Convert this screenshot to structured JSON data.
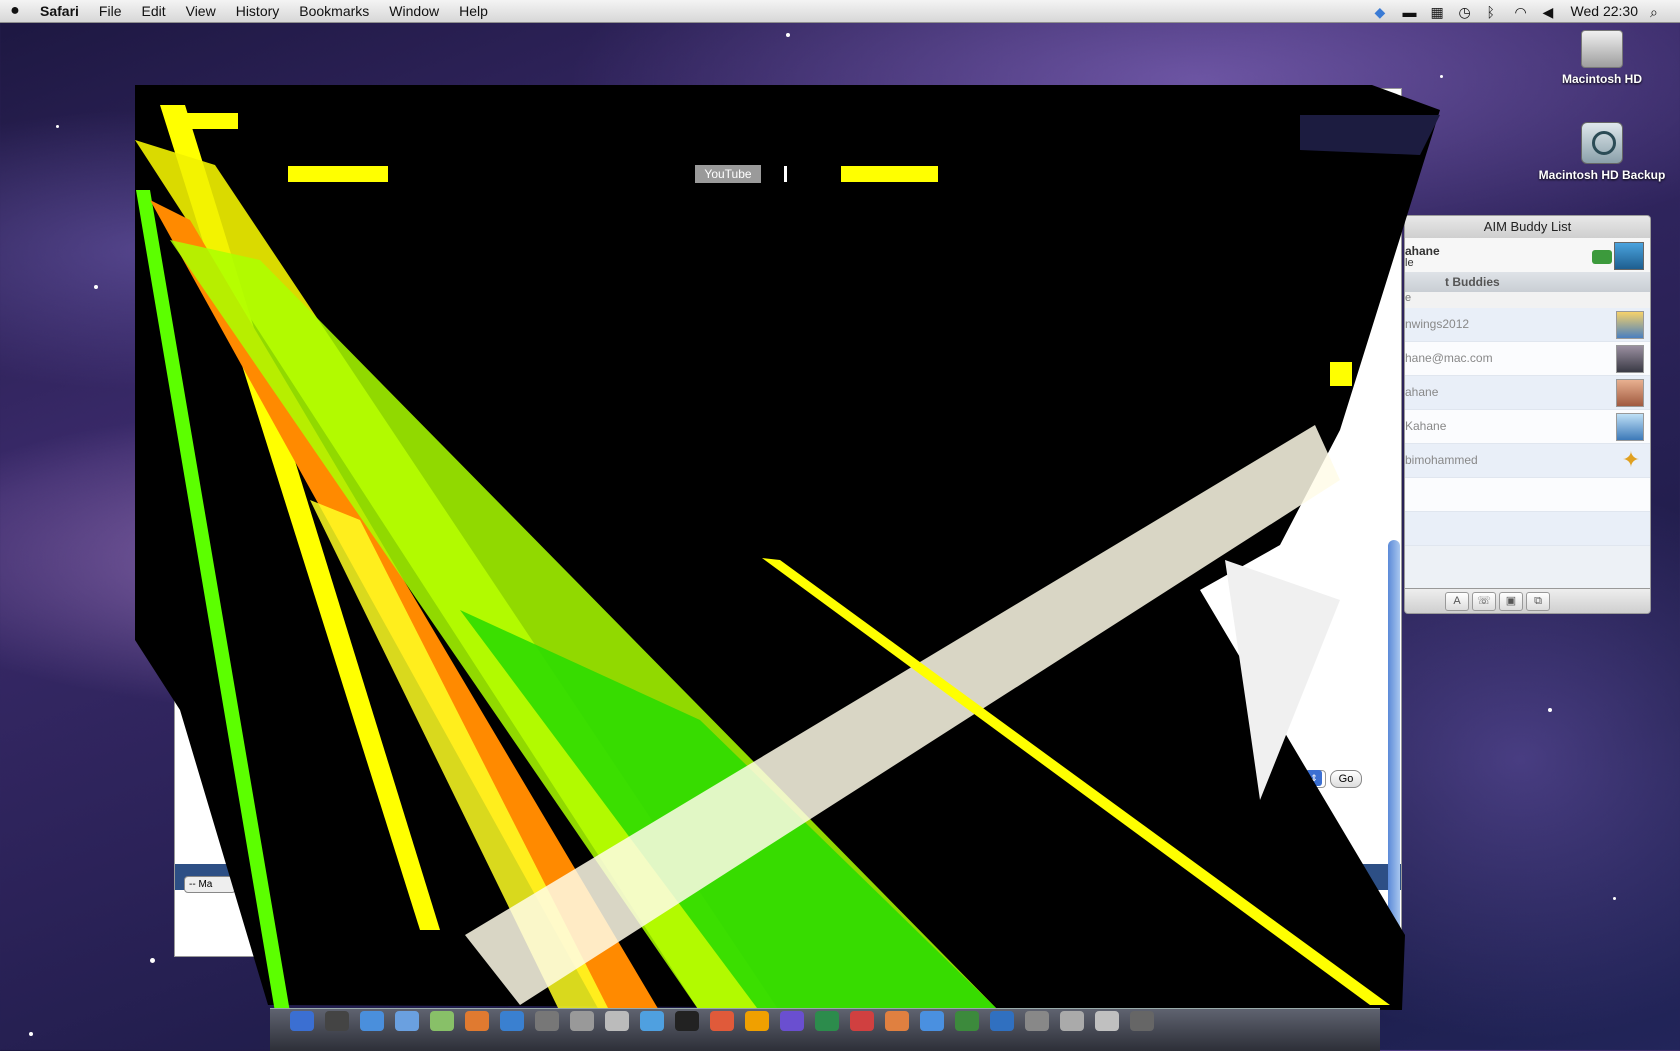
{
  "menubar": {
    "app_name": "Safari",
    "items": [
      "File",
      "Edit",
      "View",
      "History",
      "Bookmarks",
      "Window",
      "Help"
    ],
    "clock": "Wed 22:30",
    "status_icons": [
      "dropbox-icon",
      "display-icon",
      "spaces-icon",
      "time-machine-icon",
      "bluetooth-icon",
      "wifi-icon",
      "volume-icon",
      "spotlight-icon"
    ]
  },
  "desktop": {
    "icons": [
      {
        "label": "Macintosh HD",
        "icon": "hard-drive-icon"
      },
      {
        "label": "Macintosh HD Backup",
        "icon": "time-machine-drive-icon"
      }
    ]
  },
  "glitch_window": {
    "youtube_label": "YouTube"
  },
  "safari_under": {
    "go_label": "Go",
    "ma_label": "-- Ma"
  },
  "aim": {
    "title": "AIM Buddy List",
    "my_name": "ahane",
    "my_status": "le",
    "group_label": "t Budd",
    "group_suffix": "ies",
    "group2_label": "e",
    "buddies": [
      {
        "prefix": "nwings",
        "suffix": "2012"
      },
      {
        "prefix": "hane@",
        "suffix": "mac.com"
      },
      {
        "prefix": "ahane",
        "suffix": ""
      },
      {
        "prefix": " Kahan",
        "suffix": "e"
      },
      {
        "prefix": "bimoha",
        "suffix": "mmed"
      }
    ],
    "toolbar_labels": [
      "A",
      "☏",
      "▣",
      "⧉"
    ]
  },
  "colors": {
    "glitch_yellow": "#ffff00",
    "glitch_green": "#66ff00",
    "glitch_orange": "#ff8800",
    "glitch_black": "#000000",
    "aim_background": "#edf1f6"
  }
}
